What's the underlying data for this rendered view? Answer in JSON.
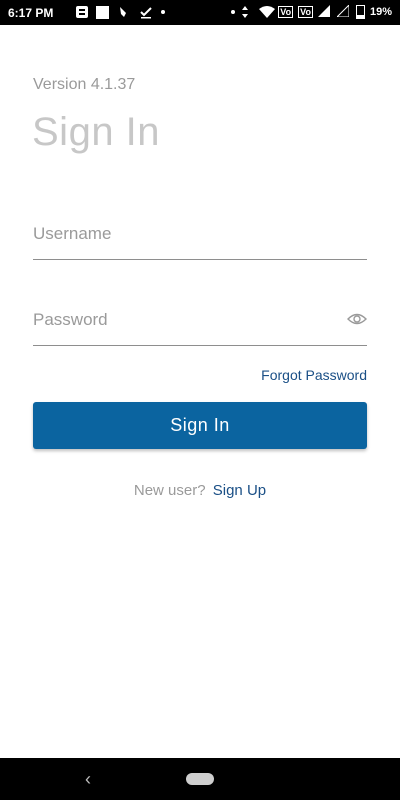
{
  "status_bar": {
    "time": "6:17 PM",
    "network_labels": [
      "Vo",
      "Vo"
    ],
    "battery_percent": "19%"
  },
  "login": {
    "version": "Version 4.1.37",
    "title": "Sign In",
    "username_placeholder": "Username",
    "password_placeholder": "Password",
    "forgot_password": "Forgot Password",
    "sign_in_button": "Sign In",
    "new_user_prompt": "New user?",
    "sign_up_link": "Sign Up"
  },
  "colors": {
    "accent": "#0b64a0",
    "link": "#1a4f86",
    "muted_text": "#9a9a9a"
  },
  "icons": {
    "status_left": [
      "message-icon",
      "square-icon",
      "key-icon",
      "check-icon",
      "dot-icon"
    ],
    "status_right": [
      "dot-icon",
      "data-arrows-icon",
      "wifi-icon",
      "lte-icon",
      "signal-icon",
      "signal-icon",
      "battery-icon"
    ],
    "password_toggle": "eye-icon",
    "nav": [
      "back-icon",
      "home-pill-icon"
    ]
  }
}
